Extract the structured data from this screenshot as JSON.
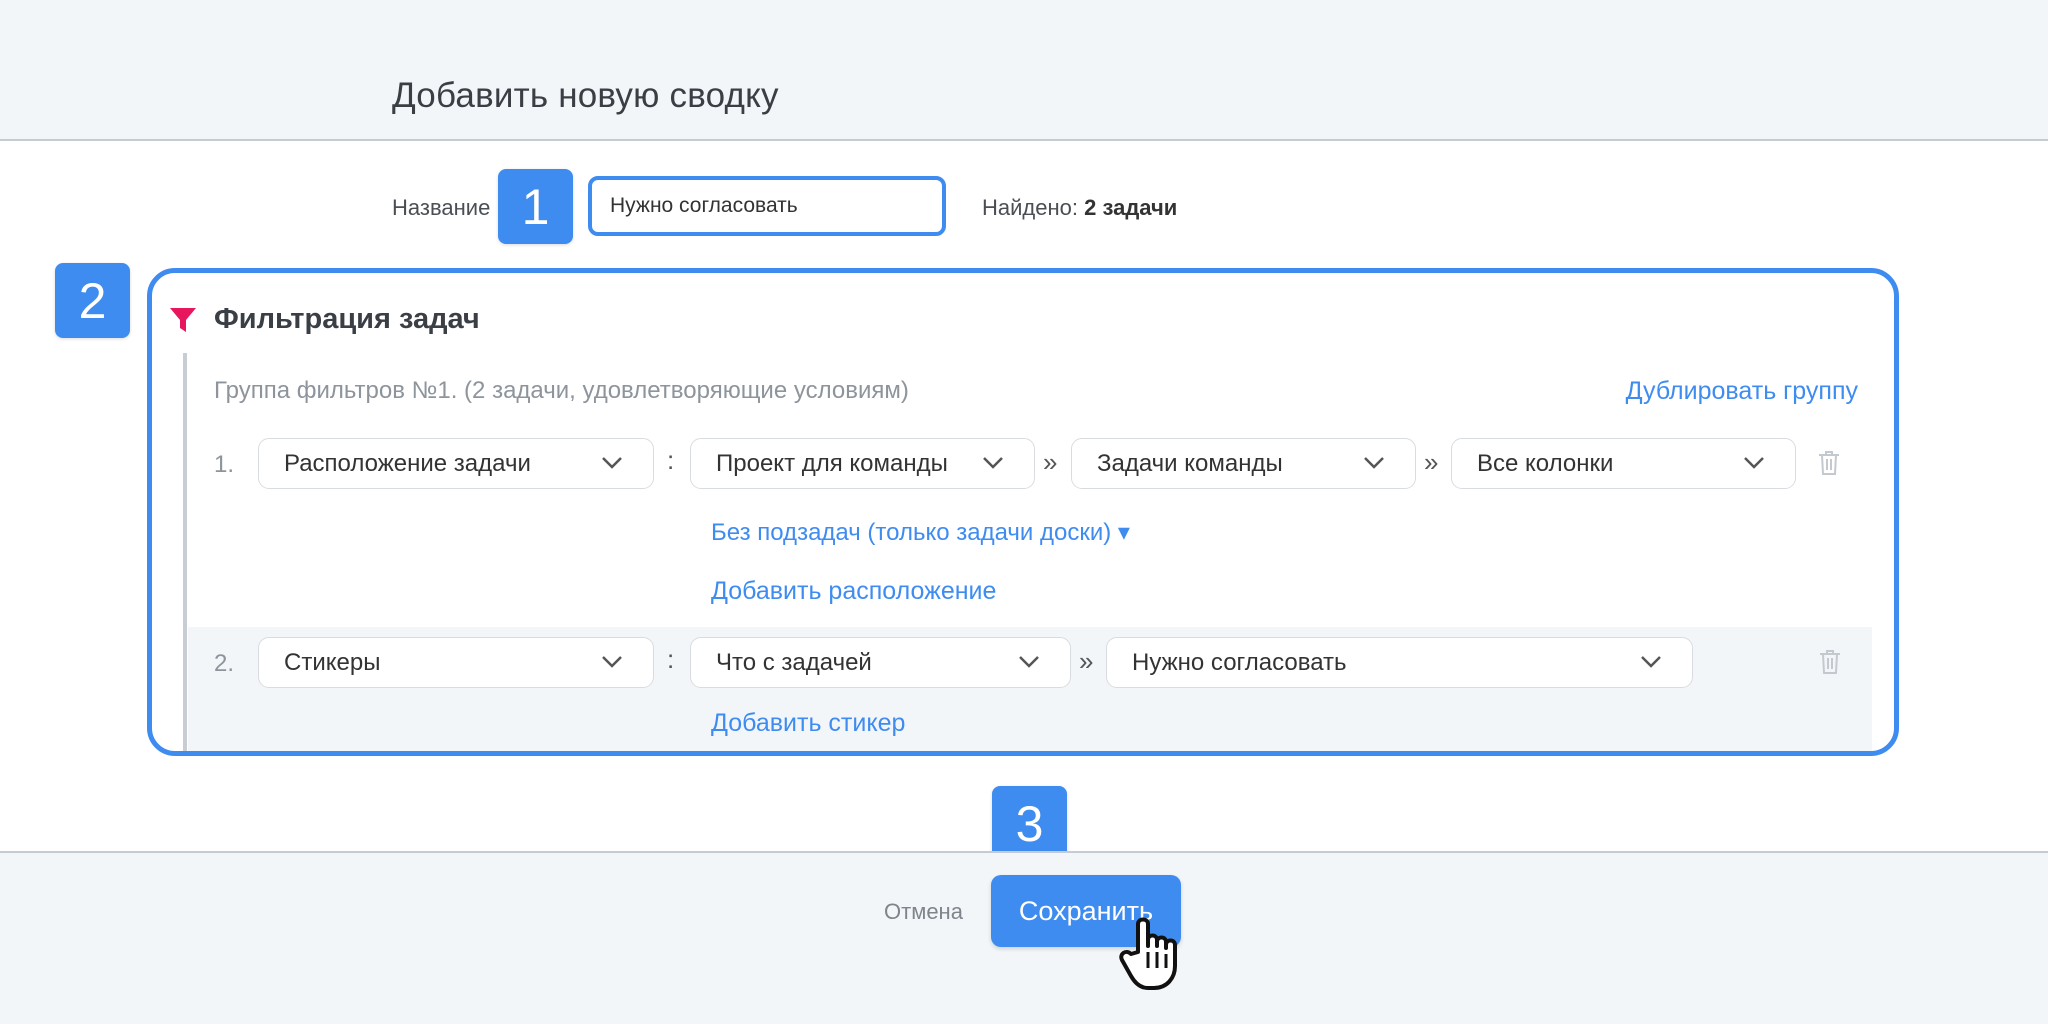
{
  "header": {
    "title": "Добавить новую сводку"
  },
  "form": {
    "name_label": "Название",
    "name_value": "Нужно согласовать",
    "found_label": "Найдено:",
    "found_value": "2 задачи"
  },
  "badges": [
    "1",
    "2",
    "3"
  ],
  "filter": {
    "title": "Фильтрация задач",
    "group_title": "Группа фильтров №1. (2 задачи, удовлетворяющие условиям)",
    "duplicate_label": "Дублировать группу",
    "rows": [
      {
        "num": "1.",
        "field": "Расположение задачи",
        "colon": ":",
        "project": "Проект для команды",
        "arrow1": "»",
        "board": "Задачи команды",
        "arrow2": "»",
        "columns": "Все колонки",
        "subtasks_label": "Без подзадач (только задачи доски) ▾",
        "add_label": "Добавить расположение"
      },
      {
        "num": "2.",
        "field": "Стикеры",
        "colon": ":",
        "sticker": "Что с задачей",
        "arrow1": "»",
        "value": "Нужно согласовать",
        "add_label": "Добавить стикер"
      }
    ]
  },
  "footer": {
    "cancel_label": "Отмена",
    "save_label": "Сохранить"
  },
  "colors": {
    "accent": "#3f8cf0",
    "filter_icon": "#e8175d",
    "band": "#f3f6f9"
  }
}
